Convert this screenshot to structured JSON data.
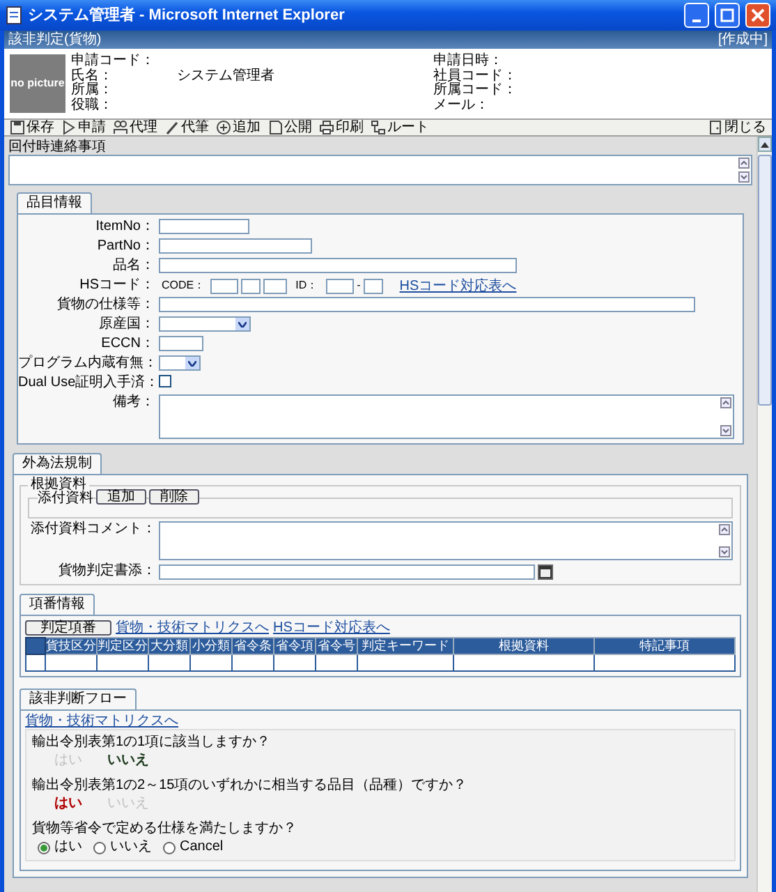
{
  "window": {
    "title": "システム管理者 - Microsoft Internet Explorer"
  },
  "header": {
    "title": "該非判定(貨物)",
    "status": "[作成中]"
  },
  "profile": {
    "photo_label": "no picture",
    "fields_left": [
      {
        "label": "申請コード："
      },
      {
        "label": "氏名：",
        "value": "システム管理者"
      },
      {
        "label": "所属："
      },
      {
        "label": "役職："
      }
    ],
    "fields_right": [
      {
        "label": "申請日時："
      },
      {
        "label": "社員コード："
      },
      {
        "label": "所属コード："
      },
      {
        "label": "メール："
      }
    ]
  },
  "toolbar": [
    {
      "kind": "save",
      "label": "保存"
    },
    {
      "kind": "apply",
      "label": "申請"
    },
    {
      "kind": "proxy",
      "label": "代理"
    },
    {
      "kind": "pen",
      "label": "代筆"
    },
    {
      "kind": "add",
      "label": "追加"
    },
    {
      "kind": "publish",
      "label": "公開"
    },
    {
      "kind": "print",
      "label": "印刷"
    },
    {
      "kind": "route",
      "label": "ルート"
    }
  ],
  "toolbar_right": {
    "kind": "close",
    "label": "閉じる"
  },
  "notes": {
    "label": "回付時連絡事項"
  },
  "item_info": {
    "tab": "品目情報",
    "fields": [
      {
        "kind": "text",
        "label": "ItemNo："
      },
      {
        "kind": "text",
        "label": "PartNo："
      },
      {
        "kind": "text",
        "label": "品名："
      },
      {
        "kind": "hscode",
        "label": "HSコード：",
        "code_label": "CODE：",
        "id_label": "ID：",
        "separator": "-",
        "link": "HSコード対応表へ"
      },
      {
        "kind": "text",
        "label": "貨物の仕様等："
      },
      {
        "kind": "select",
        "label": "原産国："
      },
      {
        "kind": "text",
        "label": "ECCN："
      },
      {
        "kind": "select",
        "label": "プログラム内蔵有無："
      },
      {
        "kind": "checkbox",
        "label": "Dual Use証明入手済：",
        "checked": false
      },
      {
        "kind": "textarea",
        "label": "備考："
      }
    ]
  },
  "regulation": {
    "tab": "外為法規制",
    "legend": "根拠資料",
    "attach_label": "添付資料",
    "attach_buttons": [
      "追加",
      "削除"
    ],
    "comment_label": "添付資料コメント：",
    "doc_label": "貨物判定書添："
  },
  "item_numbers": {
    "tab": "項番情報",
    "button": "判定項番",
    "links": [
      "貨物・技術マトリクスへ",
      "HSコード対応表へ"
    ],
    "columns": [
      "貨技区分",
      "判定区分",
      "大分類",
      "小分類",
      "省令条",
      "省令項",
      "省令号",
      "判定キーワード",
      "根拠資料",
      "特記事項"
    ]
  },
  "flow": {
    "tab": "該非判断フロー",
    "link": "貨物・技術マトリクスへ",
    "questions": [
      {
        "kind": "answered",
        "text": "輸出令別表第1の1項に該当しますか？",
        "options": [
          {
            "label": "はい",
            "selected": false
          },
          {
            "label": "いいえ",
            "selected": true
          }
        ]
      },
      {
        "kind": "answered",
        "text": "輸出令別表第1の2～15項のいずれかに相当する品目（品種）ですか？",
        "options": [
          {
            "label": "はい",
            "selected": true
          },
          {
            "label": "いいえ",
            "selected": false
          }
        ]
      },
      {
        "kind": "radio",
        "text": "貨物等省令で定める仕様を満たしますか？",
        "options": [
          {
            "label": "はい",
            "selected": true
          },
          {
            "label": "いいえ",
            "selected": false
          },
          {
            "label": "Cancel",
            "selected": false
          }
        ]
      }
    ]
  }
}
